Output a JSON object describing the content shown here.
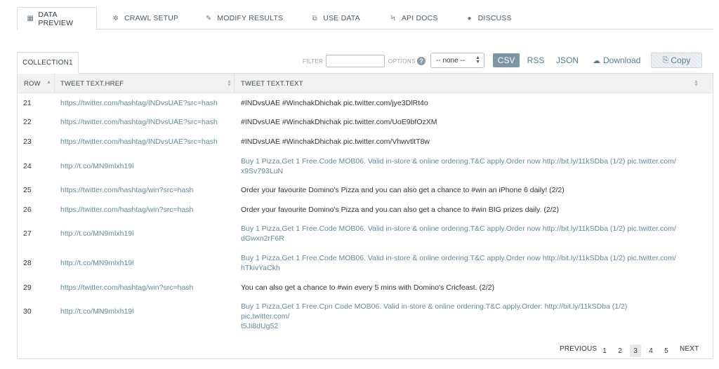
{
  "nav": {
    "tabs": [
      {
        "label": "DATA PREVIEW",
        "icon": "table-icon"
      },
      {
        "label": "CRAWL SETUP",
        "icon": "gear-icon"
      },
      {
        "label": "MODIFY RESULTS",
        "icon": "pencil-icon"
      },
      {
        "label": "USE DATA",
        "icon": "external-link-icon"
      },
      {
        "label": "API DOCS",
        "icon": "bolt-icon"
      },
      {
        "label": "DISCUSS",
        "icon": "chat-icon"
      }
    ]
  },
  "collection": {
    "tab_label": "COLLECTION1"
  },
  "toolbar": {
    "filter_label": "FILTER",
    "filter_value": "",
    "options_label": "OPTIONS",
    "select_value": "-- none --",
    "formats": [
      "CSV",
      "RSS",
      "JSON"
    ],
    "active_format": "CSV",
    "download_label": "Download",
    "copy_label": "Copy"
  },
  "table": {
    "columns": [
      "ROW",
      "TWEET TEXT.HREF",
      "TWEET TEXT.TEXT"
    ],
    "rows": [
      {
        "row": "21",
        "href": "https://twitter.com/hashtag/INDvsUAE?src=hash",
        "text": "#INDvsUAE #WinchakDhichak pic.twitter.com/jye3DlRt4o",
        "text2": ""
      },
      {
        "row": "22",
        "href": "https://twitter.com/hashtag/INDvsUAE?src=hash",
        "text": "#INDvsUAE #WinchakDhichak pic.twitter.com/UoE9bfOzXM",
        "text2": ""
      },
      {
        "row": "23",
        "href": "https://twitter.com/hashtag/INDvsUAE?src=hash",
        "text": "#INDvsUAE #WinchakDhichak pic.twitter.com/VhwvtltT8w",
        "text2": ""
      },
      {
        "row": "24",
        "href": "http://t.co/MN9mlxh19l",
        "text": "Buy 1 Pizza,Get 1 Free.Code MOB06. Valid in-store & online ordering.T&C apply.Order now http://bit.ly/11kSDba  (1/2) pic.twitter.com/",
        "text2": "x9Sv793LuN"
      },
      {
        "row": "25",
        "href": "https://twitter.com/hashtag/win?src=hash",
        "text": "Order your favourite Domino's Pizza and you can also get a chance to #win an iPhone 6 daily! (2/2)",
        "text2": ""
      },
      {
        "row": "26",
        "href": "https://twitter.com/hashtag/win?src=hash",
        "text": "Order your favourite Domino's Pizza and you can also get a chance to #win BIG prizes daily. (2/2)",
        "text2": ""
      },
      {
        "row": "27",
        "href": "http://t.co/MN9mlxh19l",
        "text": "Buy 1 Pizza,Get 1 Free.Code MOB06. Valid in-store & online ordering.T&C apply.Order now http://bit.ly/11kSDba  (1/2) pic.twitter.com/",
        "text2": "dGwxn2rF6R"
      },
      {
        "row": "28",
        "href": "http://t.co/MN9mlxh19l",
        "text": "Buy 1 Pizza,Get 1 Free.Code MOB06. Valid in-store & online ordering.T&C apply.Order now http://bit.ly/11kSDba  (1/2) pic.twitter.com/",
        "text2": "hTkivYaCkh"
      },
      {
        "row": "29",
        "href": "https://twitter.com/hashtag/win?src=hash",
        "text": "You can also get a chance to #win every 5 mins with Domino's Cricfeast. (2/2)",
        "text2": ""
      },
      {
        "row": "30",
        "href": "http://t.co/MN9mlxh19l",
        "text": "Buy 1 Pizza,Get 1 Free.Cpn Code MOB06. Valid in-store & online ordering.T&C apply.Order: http://bit.ly/11kSDba  (1/2) pic.twitter.com/",
        "text2": "t5Ji8dUg52"
      }
    ]
  },
  "pagination": {
    "previous_label": "PREVIOUS",
    "pages": [
      "1",
      "2",
      "3",
      "4",
      "5"
    ],
    "current_page": "3",
    "next_label": "NEXT"
  }
}
